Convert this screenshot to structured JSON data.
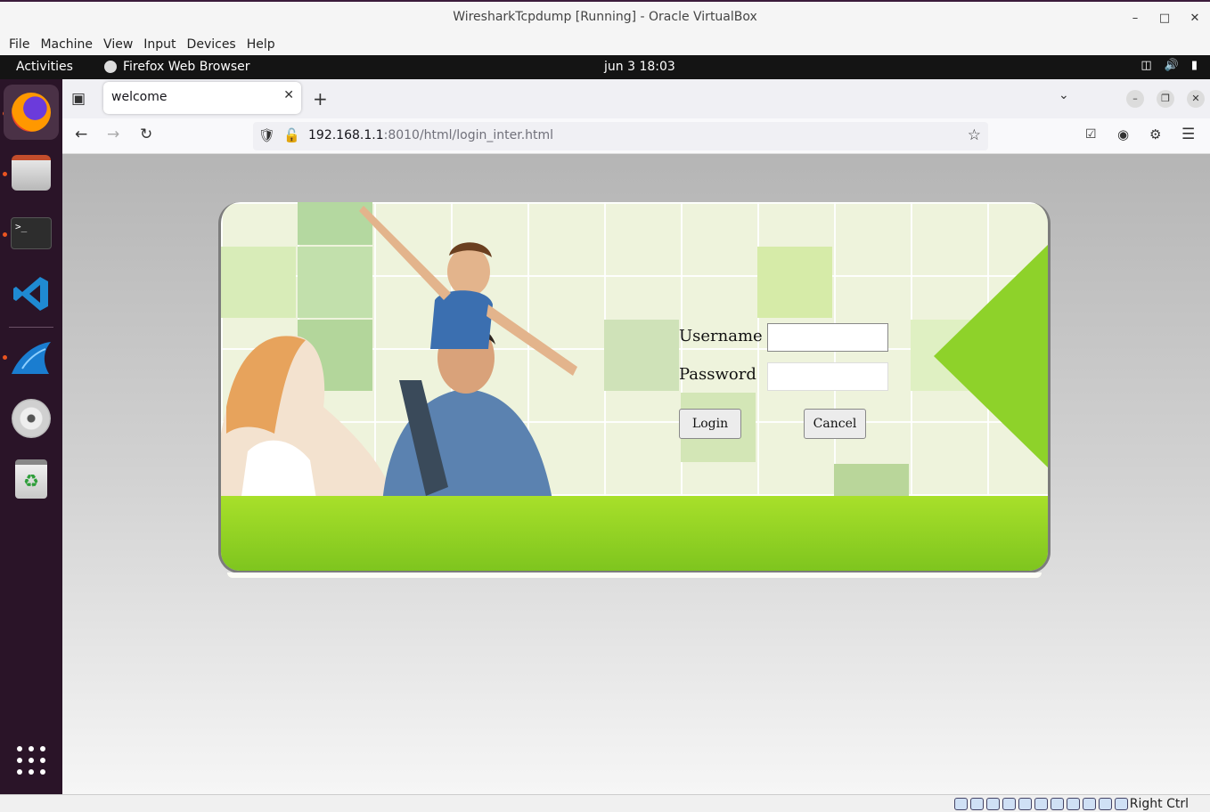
{
  "vbox": {
    "window_title": "WiresharkTcpdump [Running] - Oracle VirtualBox",
    "menu": [
      "File",
      "Machine",
      "View",
      "Input",
      "Devices",
      "Help"
    ],
    "host_key": "Right Ctrl"
  },
  "gnome": {
    "activities": "Activities",
    "app_name": "Firefox Web Browser",
    "clock": "jun 3  18:03"
  },
  "dock": {
    "items": [
      "Firefox",
      "Files",
      "Terminal",
      "Visual Studio Code",
      "Wireshark",
      "DVD",
      "Trash",
      "Show Applications"
    ]
  },
  "browser": {
    "tab_title": "welcome",
    "url_host": "192.168.1.1",
    "url_rest": ":8010/html/login_inter.html"
  },
  "login": {
    "username_label": "Username",
    "password_label": "Password",
    "username_value": "",
    "password_value": "",
    "login_button": "Login",
    "cancel_button": "Cancel"
  },
  "colors": {
    "brand_green": "#8ed22a",
    "dock_bg": "#2a1428",
    "gnome_bar": "#141414"
  }
}
